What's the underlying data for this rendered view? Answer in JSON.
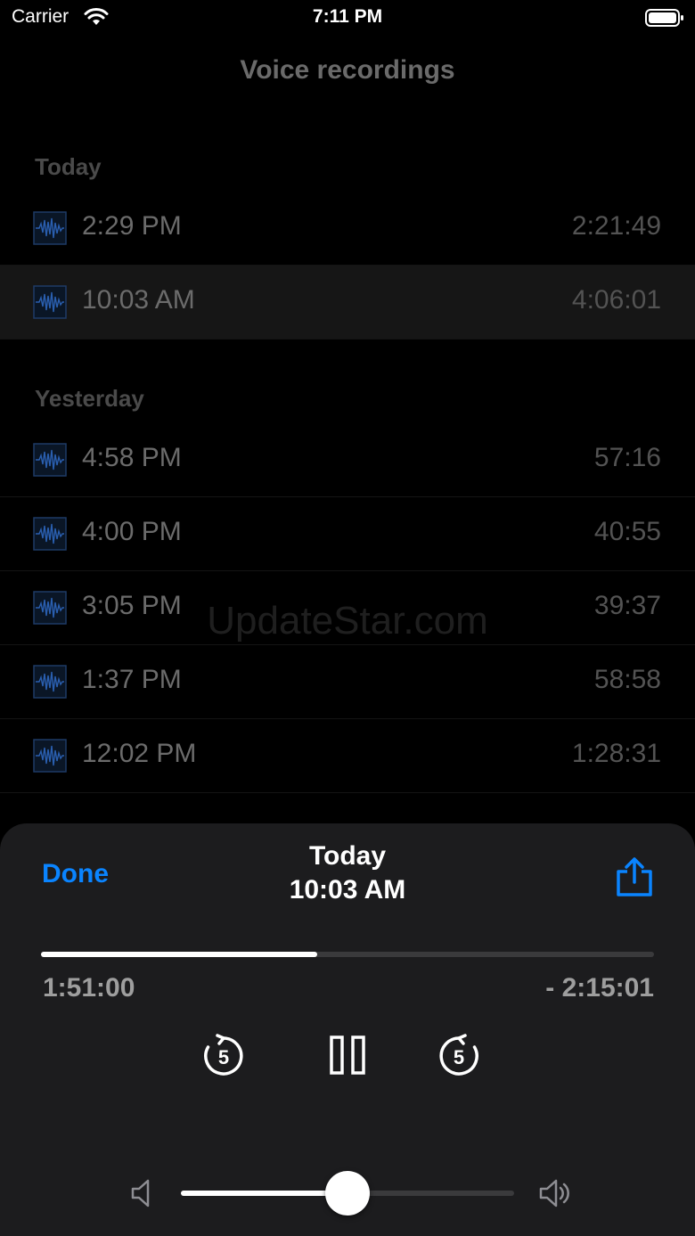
{
  "status_bar": {
    "carrier": "Carrier",
    "time": "7:11 PM"
  },
  "nav": {
    "title": "Voice recordings"
  },
  "sections": [
    {
      "header": "Today",
      "rows": [
        {
          "time": "2:29 PM",
          "duration": "2:21:49"
        },
        {
          "time": "10:03 AM",
          "duration": "4:06:01",
          "selected": true
        }
      ]
    },
    {
      "header": "Yesterday",
      "rows": [
        {
          "time": "4:58 PM",
          "duration": "57:16"
        },
        {
          "time": "4:00 PM",
          "duration": "40:55"
        },
        {
          "time": "3:05 PM",
          "duration": "39:37"
        },
        {
          "time": "1:37 PM",
          "duration": "58:58"
        },
        {
          "time": "12:02 PM",
          "duration": "1:28:31"
        }
      ]
    }
  ],
  "watermark": "UpdateStar.com",
  "player": {
    "done_label": "Done",
    "day": "Today",
    "time": "10:03 AM",
    "elapsed": "1:51:00",
    "remaining": "- 2:15:01",
    "progress_fraction": 0.45,
    "skip_back_seconds": "5",
    "skip_forward_seconds": "5",
    "volume_fraction": 0.5
  },
  "icons": {
    "wifi": "wifi-icon",
    "battery": "battery-icon",
    "recording": "waveform-icon",
    "share": "share-icon",
    "skip_back": "skip-back-5-icon",
    "pause": "pause-icon",
    "skip_forward": "skip-forward-5-icon",
    "volume_low": "speaker-low-icon",
    "volume_high": "speaker-high-icon"
  },
  "colors": {
    "accent": "#0a84ff",
    "sheet": "#1c1c1e",
    "background": "#000000"
  }
}
